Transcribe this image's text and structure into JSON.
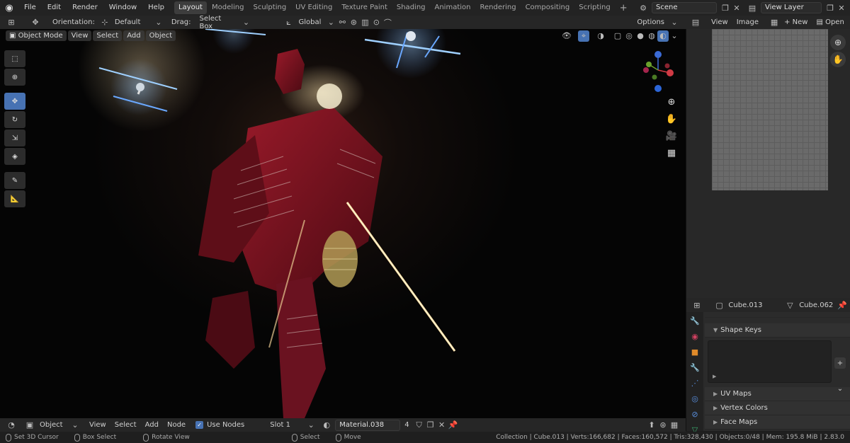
{
  "menu": {
    "items": [
      "File",
      "Edit",
      "Render",
      "Window",
      "Help"
    ],
    "workspaces": [
      "Layout",
      "Modeling",
      "Sculpting",
      "UV Editing",
      "Texture Paint",
      "Shading",
      "Animation",
      "Rendering",
      "Compositing",
      "Scripting"
    ],
    "active_workspace": "Layout",
    "scene": "Scene",
    "view_layer": "View Layer"
  },
  "viewport_header": {
    "orientation_label": "Orientation:",
    "orientation_value": "Default",
    "drag_label": "Drag:",
    "drag_value": "Select Box",
    "transform_space": "Global",
    "options": "Options"
  },
  "viewport_header2": {
    "mode": "Object Mode",
    "menus": [
      "View",
      "Select",
      "Add",
      "Object"
    ]
  },
  "image_editor_header": {
    "menus": [
      "View",
      "Image"
    ],
    "new_label": "New",
    "open_label": "Open"
  },
  "properties": {
    "object_name": "Cube.013",
    "mesh_name": "Cube.062",
    "panels": {
      "shape_keys": "Shape Keys",
      "uv_maps": "UV Maps",
      "vertex_colors": "Vertex Colors",
      "face_maps": "Face Maps"
    }
  },
  "shader_header": {
    "context": "Object",
    "menus": [
      "View",
      "Select",
      "Add",
      "Node"
    ],
    "use_nodes": "Use Nodes",
    "slot": "Slot 1",
    "material": "Material.038",
    "user_count": "4"
  },
  "statusbar": {
    "hints": [
      "Set 3D Cursor",
      "Box Select",
      "Rotate View",
      "Select",
      "Move"
    ],
    "stats": "Collection | Cube.013 | Verts:166,682 | Faces:160,572 | Tris:328,430 | Objects:0/48 | Mem: 195.8 MiB | 2.83.0"
  },
  "colors": {
    "accent": "#4772b3",
    "light_blue": "#6aa8ff",
    "glow_warm": "#ffe7b0",
    "armor_red": "#7a1422"
  }
}
